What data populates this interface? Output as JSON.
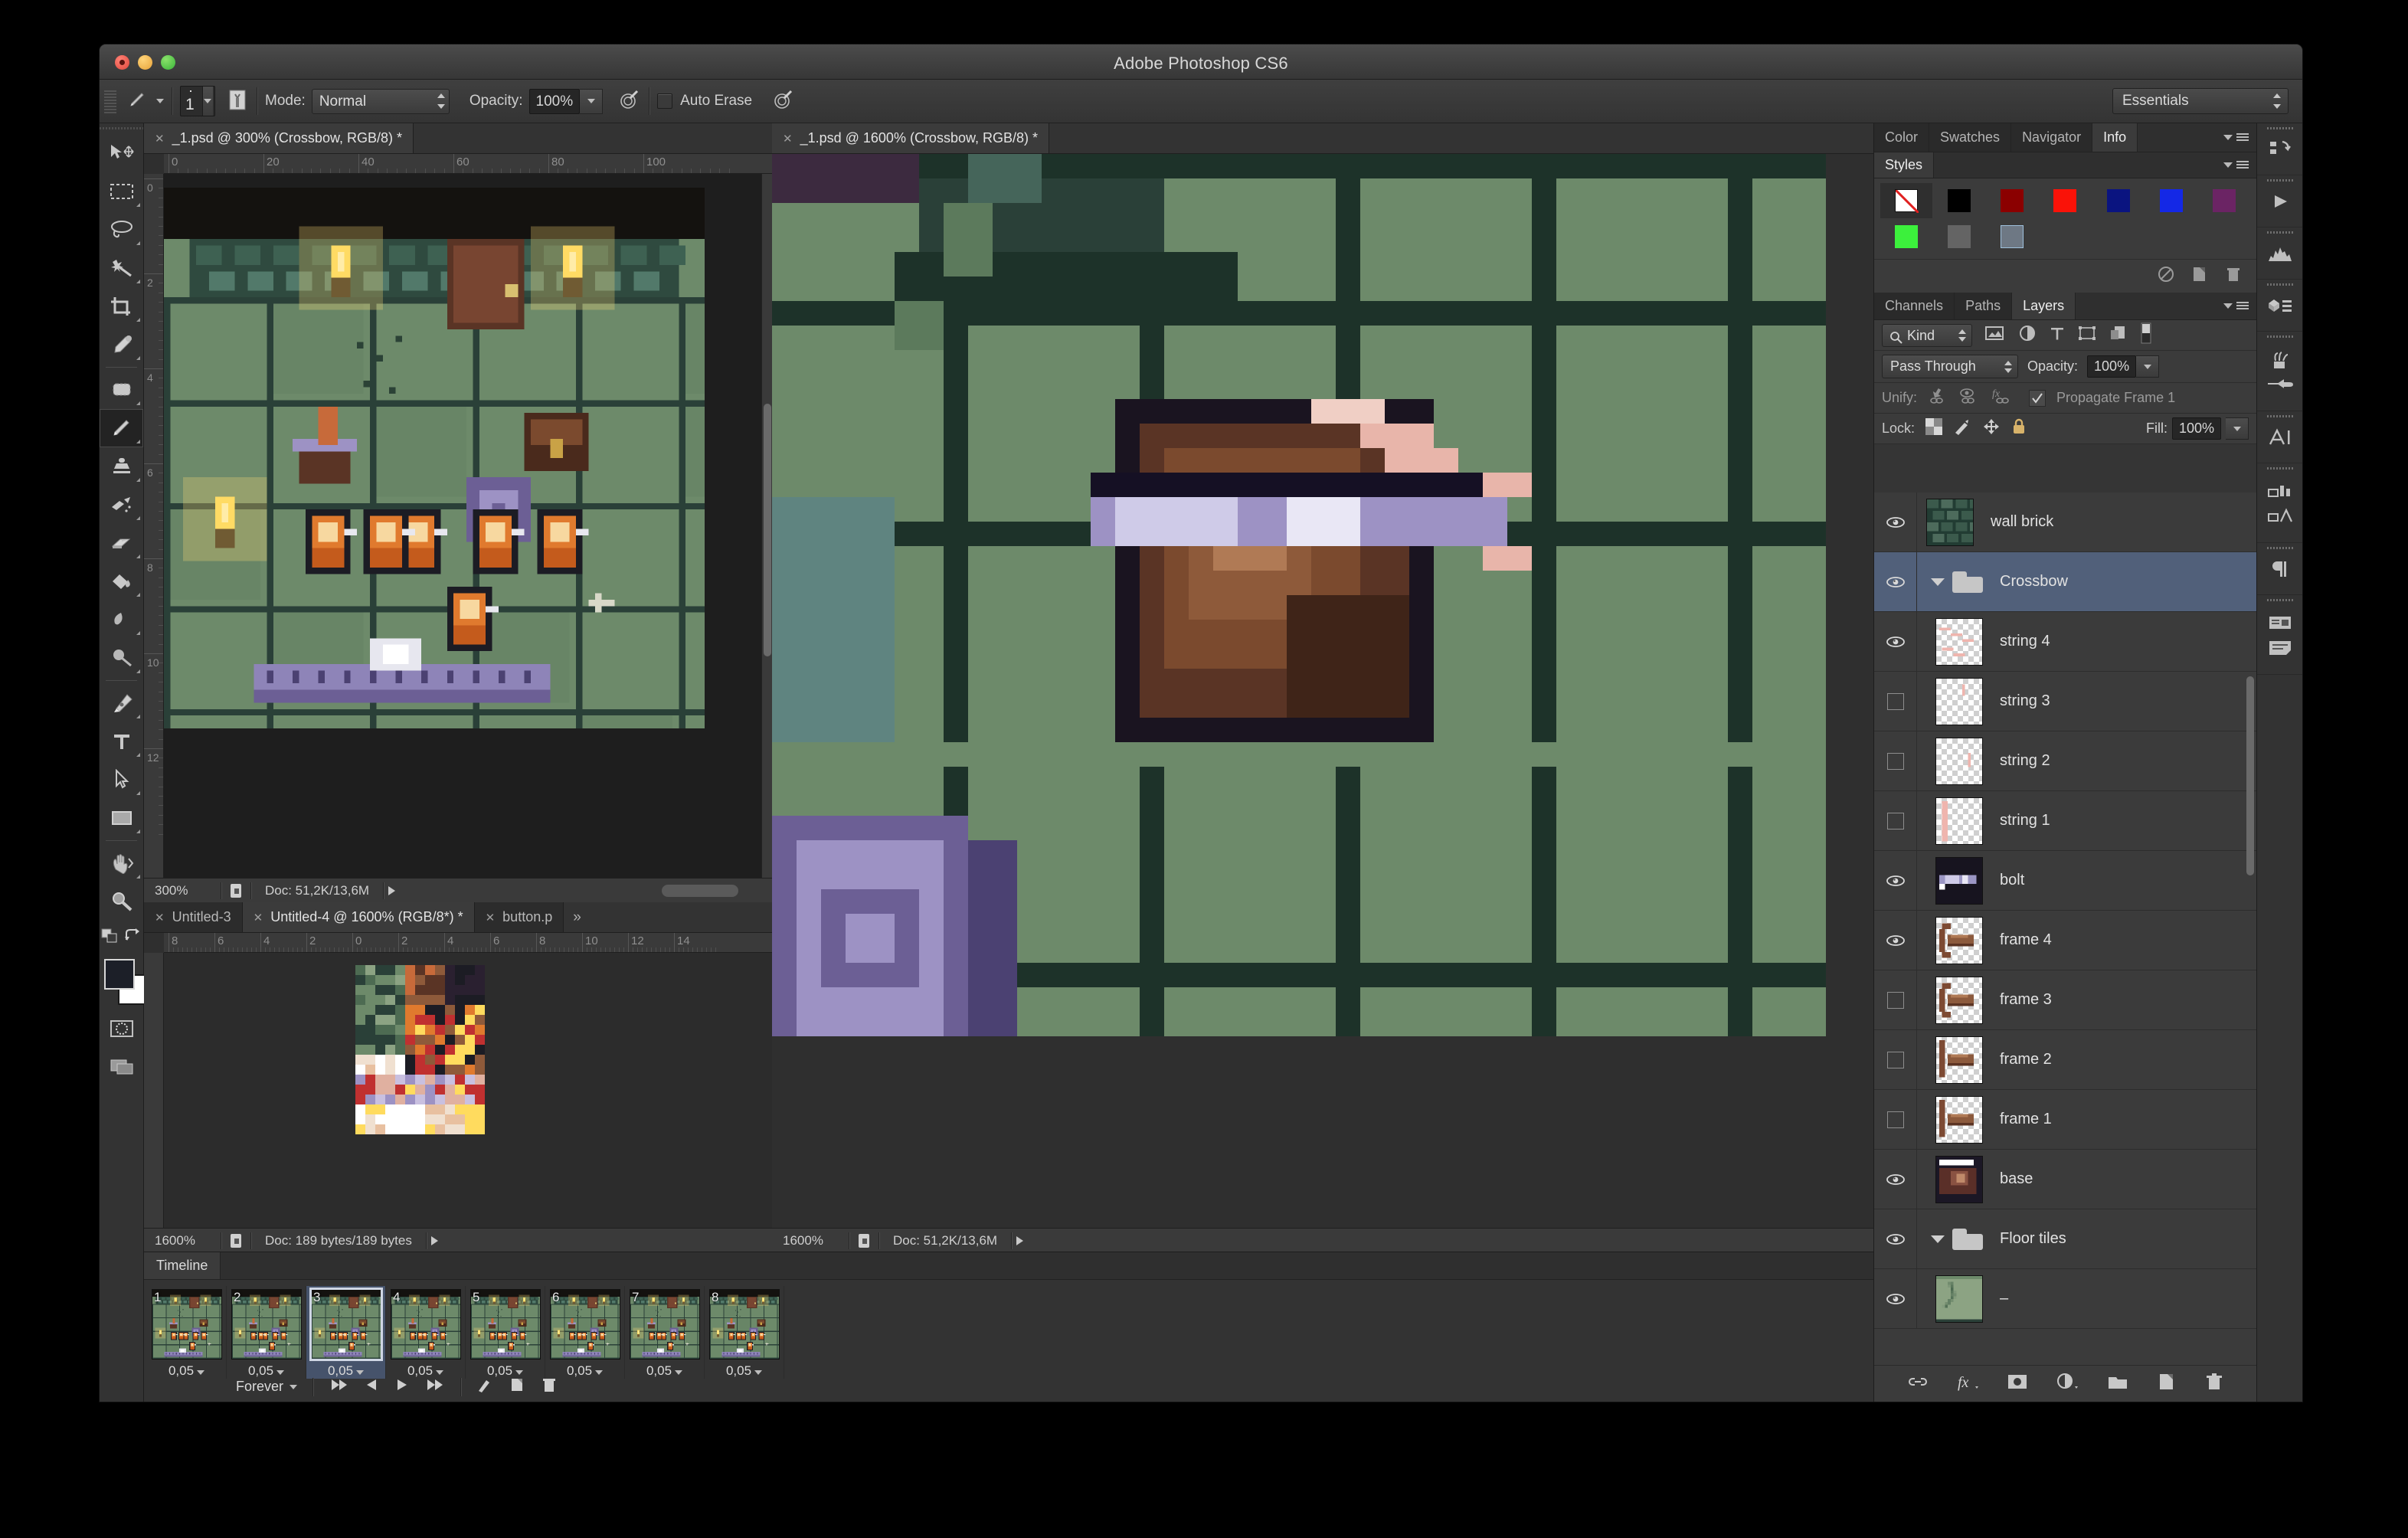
{
  "app": {
    "title": "Adobe Photoshop CS6",
    "workspace": "Essentials"
  },
  "options_bar": {
    "tool_icon": "pencil-icon",
    "brush_size": "1",
    "mode_label": "Mode:",
    "mode_value": "Normal",
    "opacity_label": "Opacity:",
    "opacity_value": "100%",
    "auto_erase_label": "Auto Erase",
    "airbrush_icon": "airbrush-icon",
    "tablet_pressure_icon": "tablet-pressure-icon"
  },
  "tools": [
    {
      "name": "move-tool",
      "icon": "move-icon"
    },
    {
      "name": "rectangular-marquee-tool",
      "icon": "marquee-icon"
    },
    {
      "name": "lasso-tool",
      "icon": "lasso-icon"
    },
    {
      "name": "magic-wand-tool",
      "icon": "magic-wand-icon"
    },
    {
      "name": "crop-tool",
      "icon": "crop-icon"
    },
    {
      "name": "eyedropper-tool",
      "icon": "eyedropper-icon"
    },
    {
      "name": "spot-healing-brush-tool",
      "icon": "healing-icon"
    },
    {
      "name": "pencil-tool",
      "icon": "pencil-icon",
      "selected": true
    },
    {
      "name": "clone-stamp-tool",
      "icon": "stamp-icon"
    },
    {
      "name": "history-brush-tool",
      "icon": "history-brush-icon"
    },
    {
      "name": "eraser-tool",
      "icon": "eraser-icon"
    },
    {
      "name": "paint-bucket-tool",
      "icon": "paint-bucket-icon"
    },
    {
      "name": "blur-tool",
      "icon": "blur-icon"
    },
    {
      "name": "dodge-tool",
      "icon": "dodge-icon"
    },
    {
      "name": "pen-tool",
      "icon": "pen-icon"
    },
    {
      "name": "type-tool",
      "icon": "type-icon"
    },
    {
      "name": "path-selection-tool",
      "icon": "path-select-icon"
    },
    {
      "name": "rectangle-tool",
      "icon": "rectangle-icon"
    },
    {
      "name": "hand-tool",
      "icon": "hand-icon"
    },
    {
      "name": "zoom-tool",
      "icon": "zoom-icon"
    }
  ],
  "documents": [
    {
      "tabs": [
        {
          "label": "_1.psd @ 300% (Crossbow, RGB/8) *",
          "active": true
        }
      ],
      "ruler_h": [
        "0",
        "20",
        "40",
        "60",
        "80",
        "100"
      ],
      "ruler_v": [
        "0",
        "2",
        "4",
        "6",
        "8",
        "10",
        "12"
      ],
      "zoom": "300%",
      "doc_size": "Doc: 51,2K/13,6M"
    },
    {
      "tabs": [
        {
          "label": "Untitled-3",
          "active": false
        },
        {
          "label": "Untitled-4 @ 1600% (RGB/8*) *",
          "active": true
        },
        {
          "label": "button.p",
          "active": false
        }
      ],
      "more": "»",
      "ruler_h": [
        "8",
        "6",
        "4",
        "2",
        "0",
        "2",
        "4",
        "6",
        "8",
        "10",
        "12",
        "14"
      ],
      "zoom": "1600%",
      "doc_size": "Doc: 189 bytes/189 bytes"
    },
    {
      "tabs": [
        {
          "label": "_1.psd @ 1600% (Crossbow, RGB/8) *",
          "active": true
        }
      ],
      "zoom": "1600%",
      "doc_size": "Doc: 51,2K/13,6M"
    }
  ],
  "right_rail": [
    {
      "name": "history-icon"
    },
    {
      "name": "actions-icon"
    },
    {
      "name": "histogram-icon"
    },
    {
      "name": "properties-icon"
    },
    {
      "name": "brush-presets-icon"
    },
    {
      "name": "brush-icon"
    },
    {
      "name": "character-icon"
    },
    {
      "name": "layer-comps-icon"
    },
    {
      "name": "character-styles-icon"
    },
    {
      "name": "paragraph-icon"
    },
    {
      "name": "notes-icon"
    },
    {
      "name": "paragraph-styles-icon"
    }
  ],
  "top_panel": {
    "tabs": [
      {
        "label": "Color",
        "active": false
      },
      {
        "label": "Swatches",
        "active": false
      },
      {
        "label": "Navigator",
        "active": false
      },
      {
        "label": "Info",
        "active": true
      }
    ],
    "styles_tab": "Styles",
    "styles": [
      {
        "name": "none",
        "color": "#ffffff",
        "slash": true
      },
      {
        "name": "black",
        "color": "#000000"
      },
      {
        "name": "dark-red",
        "color": "#8b0000"
      },
      {
        "name": "red",
        "color": "#fa1208"
      },
      {
        "name": "navy",
        "color": "#0a1480"
      },
      {
        "name": "blue",
        "color": "#1428e6"
      },
      {
        "name": "purple",
        "color": "#6b2464"
      },
      {
        "name": "green",
        "color": "#3cf03c"
      },
      {
        "name": "gray",
        "color": "#646464"
      },
      {
        "name": "steel",
        "color": "#6e7884"
      }
    ],
    "footer_icons": [
      "clear-style-icon",
      "new-style-icon",
      "delete-style-icon"
    ]
  },
  "layers_panel": {
    "tabs": [
      {
        "label": "Channels",
        "active": false
      },
      {
        "label": "Paths",
        "active": false
      },
      {
        "label": "Layers",
        "active": true
      }
    ],
    "filter_label": "Kind",
    "filter_icons": [
      "pixel-filter-icon",
      "adjustment-filter-icon",
      "type-filter-icon",
      "shape-filter-icon",
      "smart-object-filter-icon",
      "filter-toggle-icon"
    ],
    "blend_mode": "Pass Through",
    "opacity_label": "Opacity:",
    "opacity_value": "100%",
    "unify_label": "Unify:",
    "unify_icons": [
      "unify-position-icon",
      "unify-visibility-icon",
      "unify-style-icon"
    ],
    "propagate_label": "Propagate Frame 1",
    "propagate_checked": true,
    "lock_label": "Lock:",
    "lock_icons": [
      "lock-transparent-icon",
      "lock-image-icon",
      "lock-position-icon",
      "lock-all-icon"
    ],
    "fill_label": "Fill:",
    "fill_value": "100%",
    "layers": [
      {
        "name": "wall brick",
        "type": "layer",
        "visible": true,
        "indent": 0,
        "thumb": "wall-brick",
        "selected": false
      },
      {
        "name": "Crossbow",
        "type": "group",
        "visible": true,
        "indent": 0,
        "expanded": true,
        "selected": true
      },
      {
        "name": "string 4",
        "type": "layer",
        "visible": true,
        "indent": 1,
        "thumb": "string4",
        "selected": false
      },
      {
        "name": "string 3",
        "type": "layer",
        "visible": false,
        "indent": 1,
        "thumb": "string3",
        "selected": false
      },
      {
        "name": "string 2",
        "type": "layer",
        "visible": false,
        "indent": 1,
        "thumb": "string2",
        "selected": false
      },
      {
        "name": "string 1",
        "type": "layer",
        "visible": false,
        "indent": 1,
        "thumb": "string1",
        "selected": false
      },
      {
        "name": "bolt",
        "type": "layer",
        "visible": true,
        "indent": 1,
        "thumb": "bolt",
        "selected": false
      },
      {
        "name": "frame 4",
        "type": "layer",
        "visible": true,
        "indent": 1,
        "thumb": "frame4",
        "selected": false
      },
      {
        "name": "frame 3",
        "type": "layer",
        "visible": false,
        "indent": 1,
        "thumb": "frame3",
        "selected": false
      },
      {
        "name": "frame 2",
        "type": "layer",
        "visible": false,
        "indent": 1,
        "thumb": "frame2",
        "selected": false
      },
      {
        "name": "frame 1",
        "type": "layer",
        "visible": false,
        "indent": 1,
        "thumb": "frame1",
        "selected": false
      },
      {
        "name": "base",
        "type": "layer",
        "visible": true,
        "indent": 1,
        "thumb": "base",
        "selected": false
      },
      {
        "name": "Floor tiles",
        "type": "group",
        "visible": true,
        "indent": 0,
        "expanded": true,
        "selected": false
      },
      {
        "name": "–",
        "type": "layer",
        "visible": true,
        "indent": 1,
        "thumb": "floor",
        "selected": false
      }
    ],
    "footer_icons": [
      "link-layers-icon",
      "layer-style-icon",
      "layer-mask-icon",
      "adjustment-layer-icon",
      "new-group-icon",
      "new-layer-icon",
      "delete-layer-icon"
    ]
  },
  "timeline": {
    "tab_label": "Timeline",
    "frames": [
      {
        "number": "1",
        "delay": "0,05",
        "selected": false
      },
      {
        "number": "2",
        "delay": "0,05",
        "selected": false
      },
      {
        "number": "3",
        "delay": "0,05",
        "selected": true
      },
      {
        "number": "4",
        "delay": "0,05",
        "selected": false
      },
      {
        "number": "5",
        "delay": "0,05",
        "selected": false
      },
      {
        "number": "6",
        "delay": "0,05",
        "selected": false
      },
      {
        "number": "7",
        "delay": "0,05",
        "selected": false
      },
      {
        "number": "8",
        "delay": "0,05",
        "selected": false
      }
    ],
    "loop": "Forever",
    "controls": [
      "select-first-frame-icon",
      "select-previous-frame-icon",
      "play-icon",
      "select-next-frame-icon",
      "tween-icon",
      "duplicate-frame-icon",
      "delete-frame-icon"
    ]
  },
  "colors": {
    "selected_layer_blue": "#51607a",
    "panel_bg": "#3b3b3b",
    "app_bg": "#2b2b2b",
    "foreground": "#1c1f28",
    "background": "#ffffff"
  }
}
